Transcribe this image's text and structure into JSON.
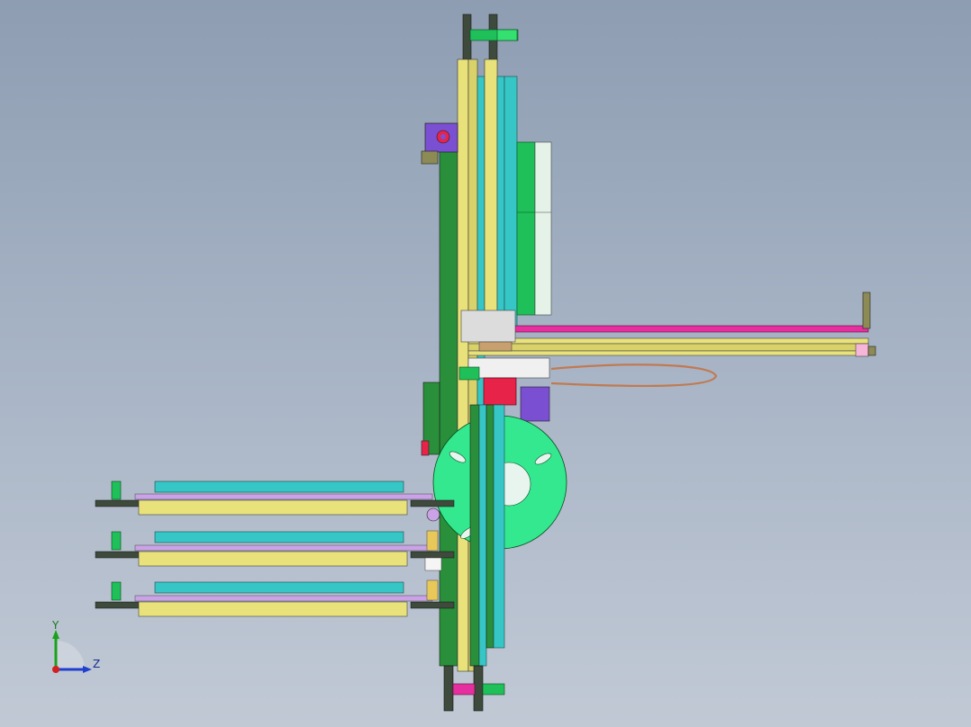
{
  "viewport": {
    "type": "cad-3d-view",
    "background_top": "#8e9db2",
    "background_bottom": "#c1c9d5"
  },
  "model": {
    "colors": {
      "yellow_rail": "#e9e27a",
      "cyan_rail": "#37c6c6",
      "green_part": "#1fbf5a",
      "mint_disc": "#33e88e",
      "magenta_bar": "#e62f9e",
      "lavender_bar": "#c9a3e6",
      "purple_block": "#7b4fd1",
      "red_part": "#e8234a",
      "olive": "#8c8a55",
      "dark_gear": "#3e4a3c",
      "cable": "#c07a52",
      "pale_panel": "#e4f2e8"
    },
    "icons": [
      "gear-icon",
      "spool-disc-icon",
      "motor-icon",
      "cable-icon"
    ]
  },
  "triad": {
    "y_label": "Y",
    "z_label": "Z",
    "x_color": "#d22020",
    "y_color": "#1aa21a",
    "z_color": "#1f3fcf"
  }
}
